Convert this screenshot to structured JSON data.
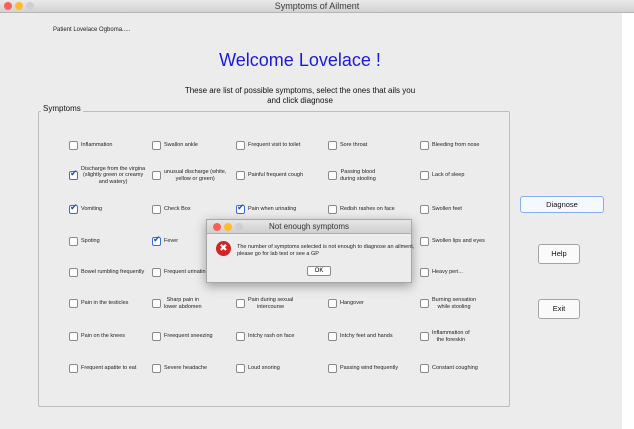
{
  "window": {
    "title": "Symptoms of Ailment"
  },
  "patient_label": "Patient Lovelace Ogboma.....",
  "welcome": "Welcome Lovelace !",
  "instructions": [
    "These are list of possible symptoms, select the ones that ails you",
    "and click diagnose"
  ],
  "group_title": "Symptoms",
  "symptoms": [
    {
      "lines": [
        "Inflammation"
      ],
      "checked": false
    },
    {
      "lines": [
        "Swallon ankle"
      ],
      "checked": false
    },
    {
      "lines": [
        "Frequent visit to toilet"
      ],
      "checked": false
    },
    {
      "lines": [
        "Sore throat"
      ],
      "checked": false
    },
    {
      "lines": [
        "Bleeding from nose"
      ],
      "checked": false
    },
    {
      "lines": [
        "Discharge from the virgina",
        "(slightly green or creamy",
        "and watery)"
      ],
      "checked": true
    },
    {
      "lines": [
        "unusual discharge (white,",
        "yellow or green)"
      ],
      "checked": false
    },
    {
      "lines": [
        "Painful frequent cough"
      ],
      "checked": false
    },
    {
      "lines": [
        "Passing blood",
        "during stooling"
      ],
      "checked": false
    },
    {
      "lines": [
        "Lack of sleep"
      ],
      "checked": false
    },
    {
      "lines": [
        "Vomiting"
      ],
      "checked": true
    },
    {
      "lines": [
        "Check Box"
      ],
      "checked": false
    },
    {
      "lines": [
        "Pain when urinating"
      ],
      "checked": true
    },
    {
      "lines": [
        "Redish rashes on face"
      ],
      "checked": false
    },
    {
      "lines": [
        "Swollen feet"
      ],
      "checked": false
    },
    {
      "lines": [
        "Spoting"
      ],
      "checked": false
    },
    {
      "lines": [
        "Fever"
      ],
      "checked": true
    },
    {
      "lines": [
        ""
      ],
      "checked": false
    },
    {
      "lines": [
        ""
      ],
      "checked": false
    },
    {
      "lines": [
        "Swollen lips and eyes"
      ],
      "checked": false
    },
    {
      "lines": [
        "Bowel rumbling frequently"
      ],
      "checked": false
    },
    {
      "lines": [
        "Frequent urinatin"
      ],
      "checked": false
    },
    {
      "lines": [
        ""
      ],
      "checked": false
    },
    {
      "lines": [
        ""
      ],
      "checked": false
    },
    {
      "lines": [
        "Heavy peri..."
      ],
      "checked": false
    },
    {
      "lines": [
        "Pain in the testicles"
      ],
      "checked": false
    },
    {
      "lines": [
        "Sharp pain in",
        "lower abdomen"
      ],
      "checked": false
    },
    {
      "lines": [
        "Pain during sexual",
        "intercourse"
      ],
      "checked": false
    },
    {
      "lines": [
        "Hangover"
      ],
      "checked": false
    },
    {
      "lines": [
        "Burning sensation",
        "while stooling"
      ],
      "checked": false
    },
    {
      "lines": [
        "Pain on the knees"
      ],
      "checked": false
    },
    {
      "lines": [
        "Freequent sneezing"
      ],
      "checked": false
    },
    {
      "lines": [
        "Intchy rash on face"
      ],
      "checked": false
    },
    {
      "lines": [
        "Intchy feet and hands"
      ],
      "checked": false
    },
    {
      "lines": [
        "Inflammation of",
        "the foreskin"
      ],
      "checked": false
    },
    {
      "lines": [
        "Frequent apatite to eat"
      ],
      "checked": false
    },
    {
      "lines": [
        "Severe headache"
      ],
      "checked": false
    },
    {
      "lines": [
        "Loud snoring"
      ],
      "checked": false
    },
    {
      "lines": [
        "Passing wind frequently"
      ],
      "checked": false
    },
    {
      "lines": [
        "Constant coughing"
      ],
      "checked": false
    }
  ],
  "buttons": {
    "diagnose": "Diagnose",
    "help": "Help",
    "exit": "Exit"
  },
  "dialog": {
    "title": "Not enough symptoms",
    "message": [
      "The number of symptoms selected is not enough to diagnose an ailment,",
      "please go for lab test or see a GP"
    ],
    "ok": "OK",
    "icon": "error-icon"
  },
  "colors": {
    "welcome": "#1a1adb",
    "error": "#d62222",
    "check": "#1f4fb8"
  }
}
